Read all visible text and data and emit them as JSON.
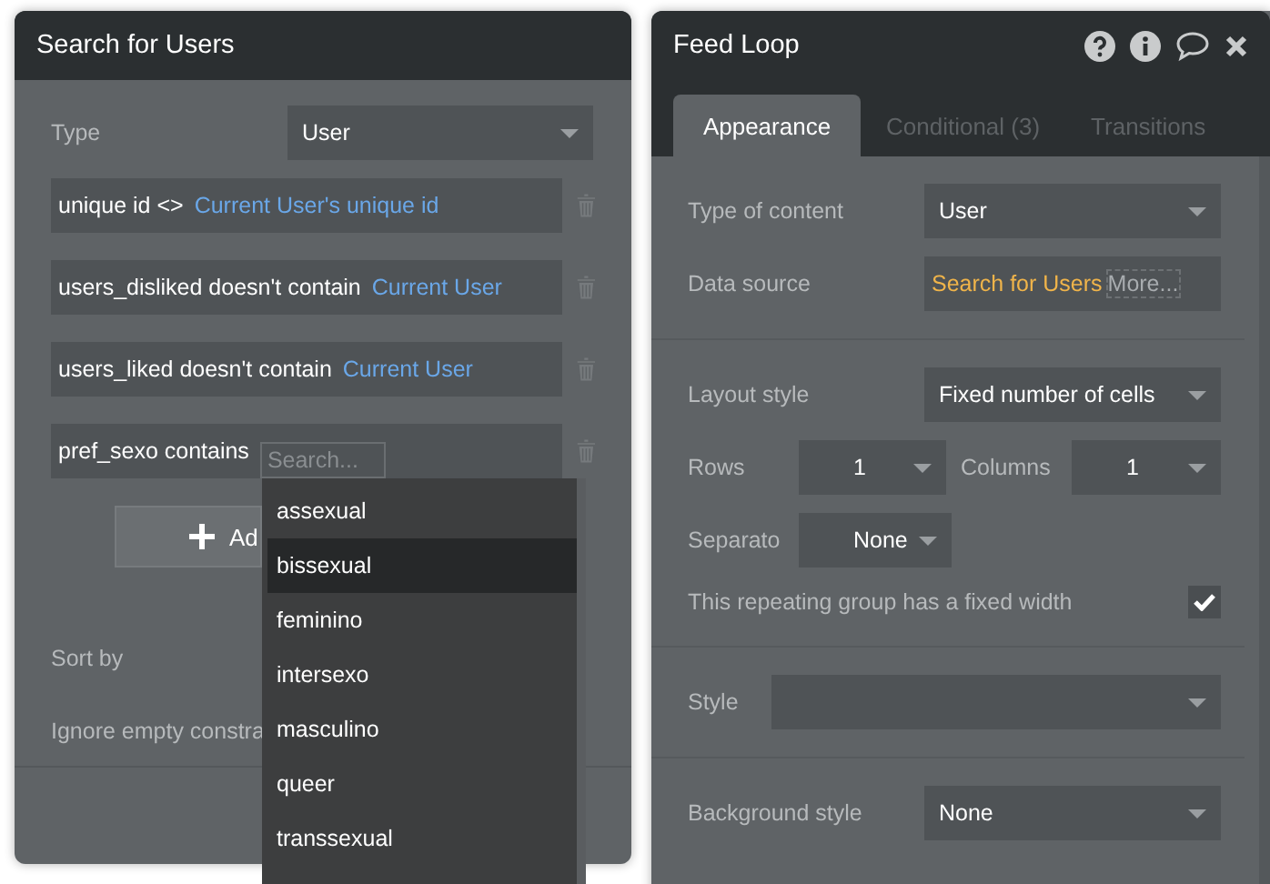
{
  "search_panel": {
    "title": "Search for Users",
    "type_label": "Type",
    "type_value": "User",
    "constraints": [
      {
        "field": "unique id <>",
        "value": "Current User's unique id"
      },
      {
        "field": "users_disliked doesn't contain",
        "value": "Current User"
      },
      {
        "field": "users_liked doesn't contain",
        "value": "Current User"
      },
      {
        "field": "pref_sexo contains",
        "search_placeholder": "Search..."
      }
    ],
    "add_button": "Ad",
    "sort_label": "Sort by",
    "ignore_label": "Ignore empty constra",
    "dropdown": [
      {
        "label": "assexual",
        "selected": false
      },
      {
        "label": "bissexual",
        "selected": true
      },
      {
        "label": "feminino",
        "selected": false
      },
      {
        "label": "intersexo",
        "selected": false
      },
      {
        "label": "masculino",
        "selected": false
      },
      {
        "label": "queer",
        "selected": false
      },
      {
        "label": "transsexual",
        "selected": false
      }
    ]
  },
  "feed_panel": {
    "title": "Feed Loop",
    "tabs": [
      {
        "label": "Appearance",
        "selected": true
      },
      {
        "label": "Conditional (3)",
        "selected": false
      },
      {
        "label": "Transitions",
        "selected": false
      }
    ],
    "type_of_content": {
      "label": "Type of content",
      "value": "User"
    },
    "data_source": {
      "label": "Data source",
      "value": "Search for Users",
      "more": "More..."
    },
    "layout_style": {
      "label": "Layout style",
      "value": "Fixed number of cells"
    },
    "rows": {
      "label": "Rows",
      "value": "1"
    },
    "columns": {
      "label": "Columns",
      "value": "1"
    },
    "separator": {
      "label": "Separato",
      "value": "None"
    },
    "fixed_width": {
      "label": "This repeating group has a fixed width",
      "checked": true
    },
    "style": {
      "label": "Style"
    },
    "background_style": {
      "label": "Background style",
      "value": "None"
    }
  }
}
